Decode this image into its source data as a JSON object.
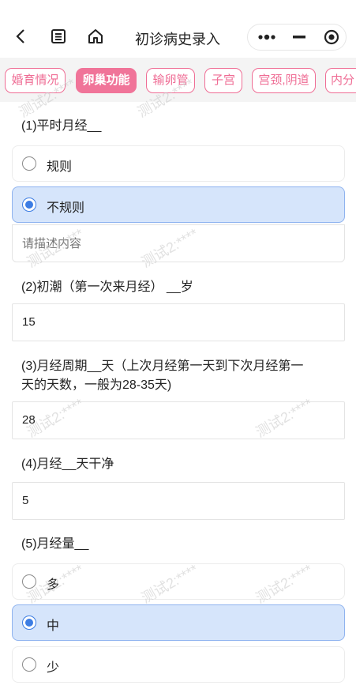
{
  "nav": {
    "title": "初诊病史录入",
    "back_icon": "chevron-left-icon",
    "list_icon": "document-list-icon",
    "home_icon": "home-icon",
    "more_icon": "more-dots-icon",
    "minimize_icon": "minimize-icon",
    "close_icon": "target-close-icon"
  },
  "tabs": [
    {
      "label": "婚育情况",
      "active": false
    },
    {
      "label": "卵巢功能",
      "active": true
    },
    {
      "label": "输卵管",
      "active": false
    },
    {
      "label": "子宫",
      "active": false
    },
    {
      "label": "宫颈,阴道",
      "active": false
    },
    {
      "label": "内分",
      "active": false
    }
  ],
  "questions": {
    "q1": {
      "label": "(1)平时月经__",
      "options": [
        {
          "label": "规则",
          "selected": false
        },
        {
          "label": "不规则",
          "selected": true
        }
      ],
      "describe_placeholder": "请描述内容"
    },
    "q2": {
      "label": "(2)初潮（第一次来月经） __岁",
      "value": "15"
    },
    "q3": {
      "label_line1": "(3)月经周期__天（上次月经第一天到下次月经第一",
      "label_line2": "天的天数，一般为28-35天)",
      "value": "28"
    },
    "q4": {
      "label": "(4)月经__天干净",
      "value": "5"
    },
    "q5": {
      "label": "(5)月经量__",
      "options": [
        {
          "label": "多",
          "selected": false
        },
        {
          "label": "中",
          "selected": true
        },
        {
          "label": "少",
          "selected": false
        }
      ]
    }
  },
  "watermark": "测试2:****",
  "colors": {
    "accent_pink": "#f07499",
    "selected_bg": "#d6e5fb",
    "radio_blue": "#3d7de3"
  }
}
